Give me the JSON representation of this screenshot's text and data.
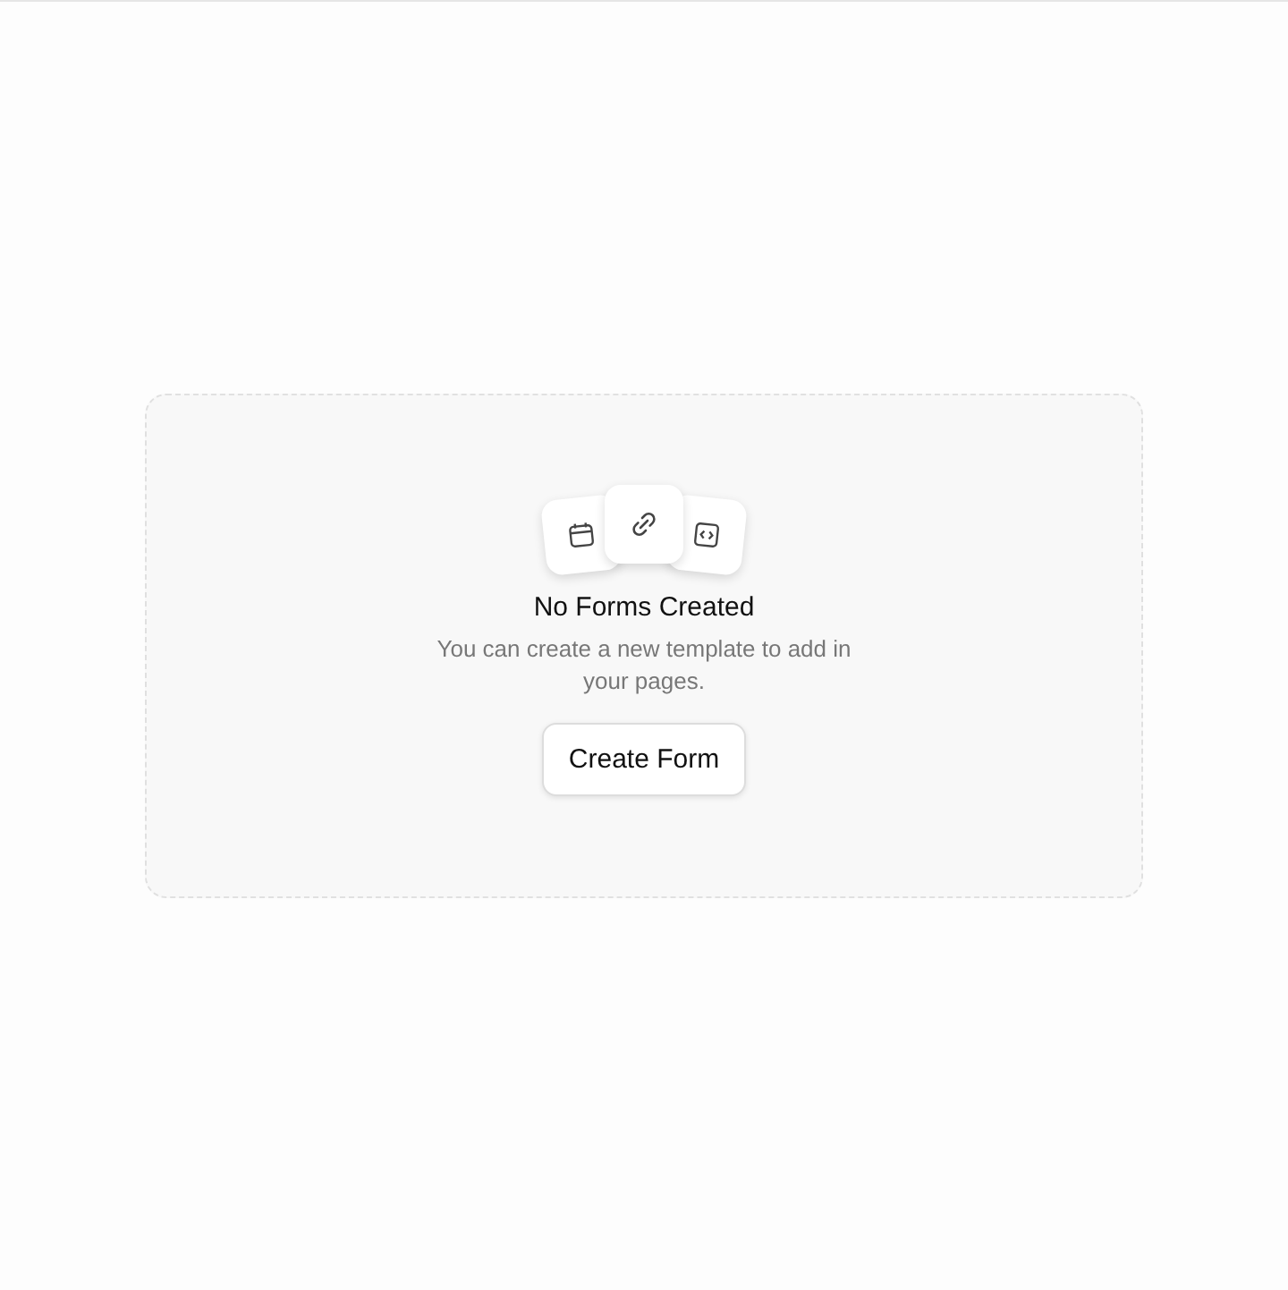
{
  "empty_state": {
    "title": "No Forms Created",
    "description": "You can create a new template to add in your pages.",
    "button": "Create Form"
  }
}
